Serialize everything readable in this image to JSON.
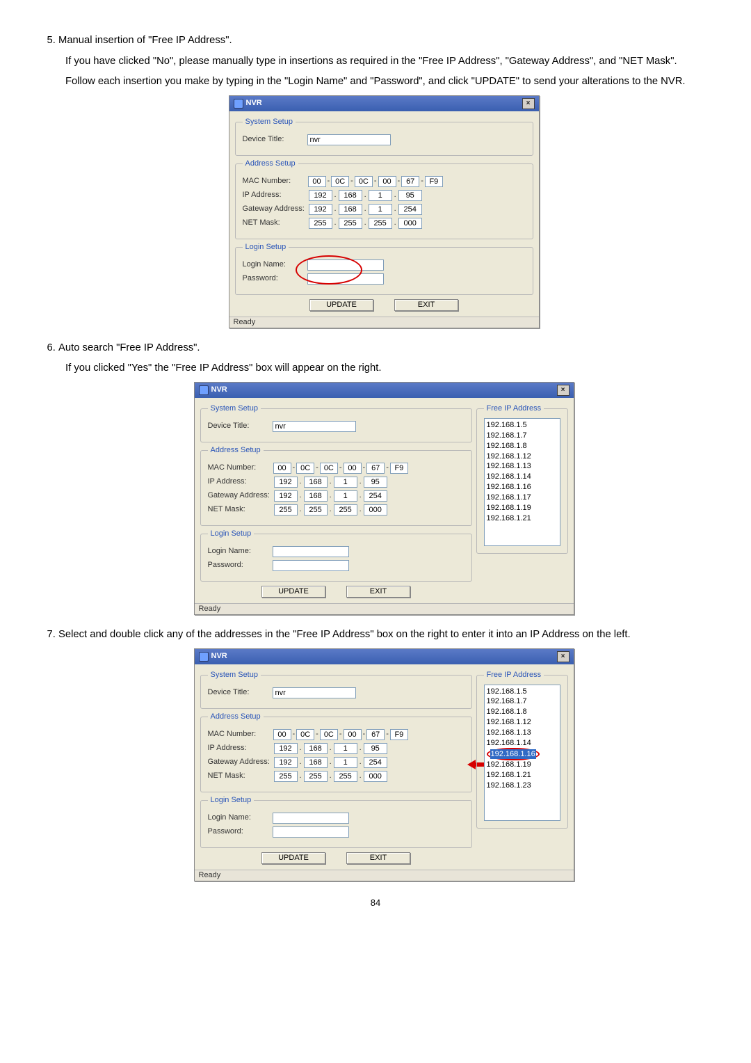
{
  "steps": {
    "s5_title": "Manual insertion of \"Free IP Address\".",
    "s5_body": "If you have clicked \"No\", please manually type in insertions as required in the \"Free IP Address\", \"Gateway Address\", and \"NET Mask\". Follow each insertion you make by typing in the \"Login Name\" and \"Password\", and click \"UPDATE\" to send your alterations to the NVR.",
    "s6_title": "Auto search \"Free IP Address\".",
    "s6_body": "If you clicked \"Yes\" the \"Free IP Address\" box will appear on the right.",
    "s7_title": "Select and double click any of the addresses in the \"Free IP Address\" box on the right to enter it into an IP Address on the left."
  },
  "dlg": {
    "title": "NVR",
    "close_x": "×",
    "legends": {
      "system": "System Setup",
      "addr": "Address Setup",
      "login": "Login Setup",
      "free": "Free IP Address"
    },
    "labels": {
      "device_title": "Device Title:",
      "mac": "MAC Number:",
      "ip": "IP Address:",
      "gateway": "Gateway Address:",
      "netmask": "NET Mask:",
      "login_name": "Login Name:",
      "password": "Password:"
    },
    "vals": {
      "device_title": "nvr",
      "mac": [
        "00",
        "0C",
        "0C",
        "00",
        "67",
        "F9"
      ],
      "ip": [
        "192",
        "168",
        "1",
        "95"
      ],
      "gateway": [
        "192",
        "168",
        "1",
        "254"
      ],
      "netmask": [
        "255",
        "255",
        "255",
        "000"
      ]
    },
    "buttons": {
      "update": "UPDATE",
      "exit": "EXIT"
    },
    "status": "Ready"
  },
  "free_list_b": [
    "192.168.1.5",
    "192.168.1.7",
    "192.168.1.8",
    "192.168.1.12",
    "192.168.1.13",
    "192.168.1.14",
    "192.168.1.16",
    "192.168.1.17",
    "192.168.1.19",
    "192.168.1.21"
  ],
  "free_list_c_pre": [
    "192.168.1.5",
    "192.168.1.7",
    "192.168.1.8",
    "192.168.1.12",
    "192.168.1.13",
    "192.168.1.14"
  ],
  "free_list_c_sel": "192.168.1.16",
  "free_list_c_post": [
    "192.168.1.19",
    "192.168.1.21",
    "192.168.1.23"
  ],
  "page_number": "84"
}
